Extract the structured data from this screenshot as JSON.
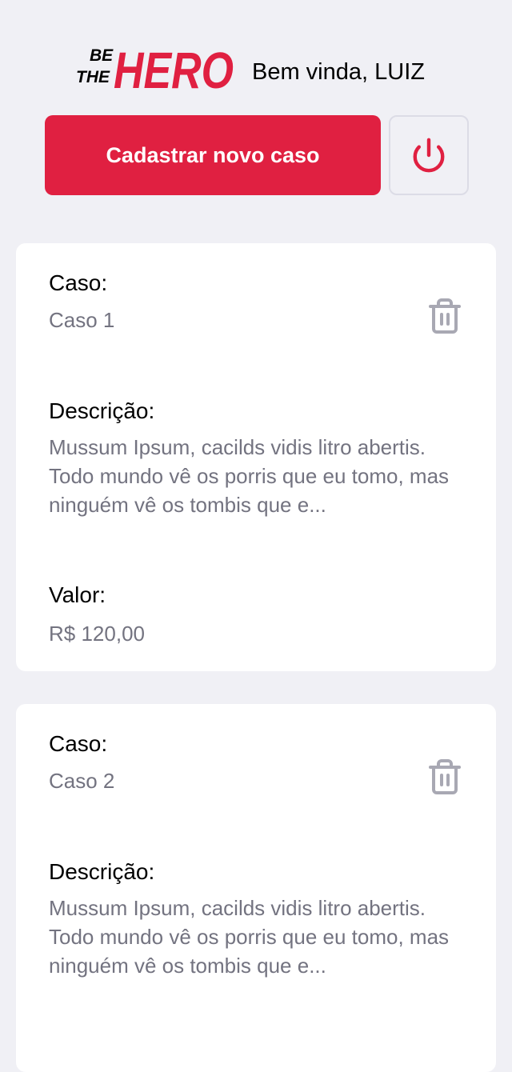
{
  "header": {
    "logo": {
      "be_text": "BE",
      "the_text": "THE",
      "hero_text": "HERO"
    },
    "welcome": "Bem vinda, LUIZ",
    "new_case_label": "Cadastrar novo caso",
    "logout_icon": "power-icon"
  },
  "labels": {
    "case": "Caso:",
    "description": "Descrição:",
    "value": "Valor:"
  },
  "cases": [
    {
      "title": "Caso 1",
      "description": "Mussum Ipsum, cacilds vidis litro abertis. Todo mundo vê os porris que eu tomo, mas ninguém vê os tombis que e...",
      "value": "R$ 120,00",
      "delete_icon": "trash-icon"
    },
    {
      "title": "Caso 2",
      "description": "Mussum Ipsum, cacilds vidis litro abertis. Todo mundo vê os porris que eu tomo, mas ninguém vê os tombis que e...",
      "delete_icon": "trash-icon"
    }
  ],
  "colors": {
    "brand": "#e02041",
    "background": "#f0f0f5",
    "muted_text": "#737380",
    "icon_gray": "#a8a8b3",
    "border": "#dcdce6"
  }
}
